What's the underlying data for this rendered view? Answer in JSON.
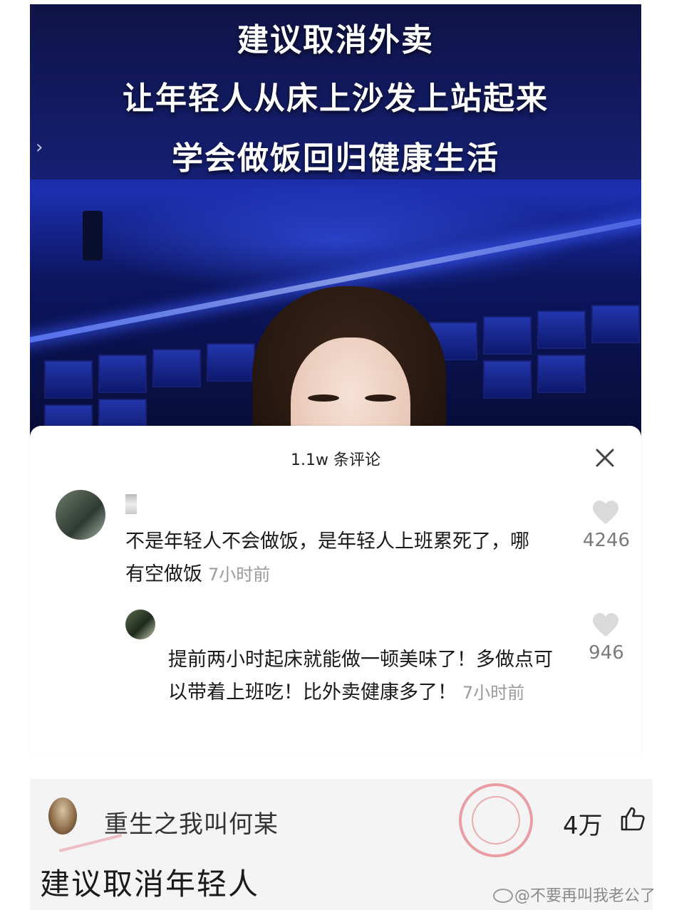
{
  "video": {
    "caption_lines": [
      "建议取消外卖",
      "让年轻人从床上沙发上站起来",
      "学会做饭回归健康生活"
    ],
    "nav_chevron": "›"
  },
  "comments_panel": {
    "title": "1.1w 条评论",
    "close_icon": "close-icon",
    "comments": [
      {
        "text": "不是年轻人不会做饭，是年轻人上班累死了，哪有空做饭",
        "time": "7小时前",
        "likes": "4246"
      },
      {
        "text": "提前两小时起床就能做一顿美味了！多做点可以带着上班吃！比外卖健康多了！",
        "time": "7小时前",
        "likes": "946"
      }
    ]
  },
  "repost_card": {
    "username": "重生之我叫何某",
    "likes": "4万",
    "like_icon": "thumbs-up-icon",
    "text": "建议取消年轻人"
  },
  "watermark": {
    "text": "@不要再叫我老公了"
  },
  "colors": {
    "video_bg": "#152074",
    "stamp": "#e25660",
    "card_bg": "#f4f4f4",
    "muted_text": "#9a9a9a"
  }
}
